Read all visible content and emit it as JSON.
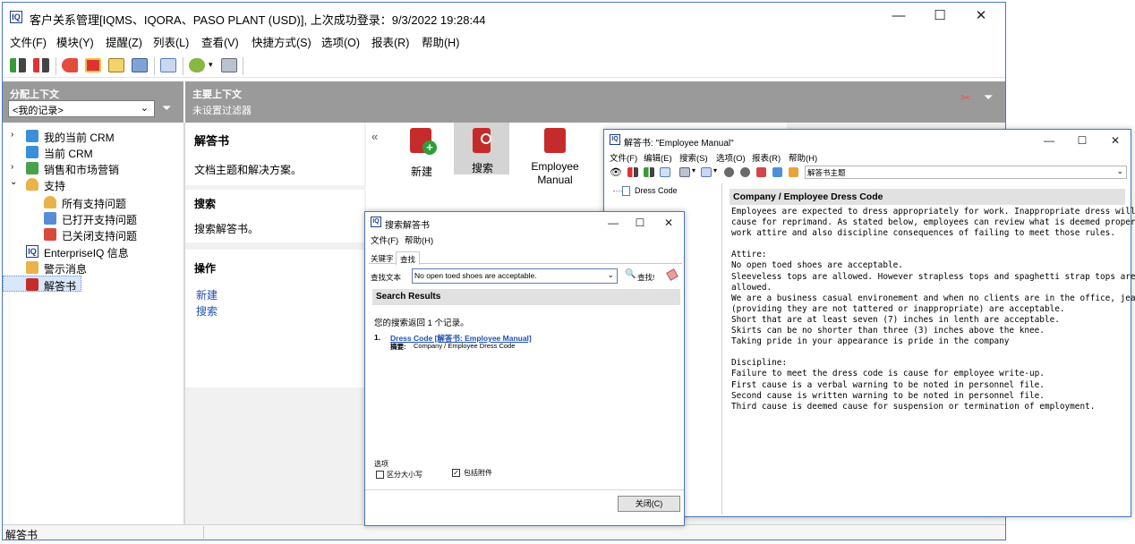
{
  "main": {
    "title": "客户关系管理[IQMS、IQORA、PASO PLANT (USD)], 上次成功登录：9/3/2022 19:28:44",
    "menu": [
      "文件(F)",
      "模块(Y)",
      "提醒(Z)",
      "列表(L)",
      "查看(V)",
      "快捷方式(S)",
      "选项(O)",
      "报表(R)",
      "帮助(H)"
    ],
    "left_header": {
      "title": "分配上下文",
      "select_value": "<我的记录>"
    },
    "tree": [
      "我的当前 CRM",
      "当前 CRM",
      "销售和市场营销",
      "支持",
      "所有支持问题",
      "已打开支持问题",
      "已关闭支持问题",
      "EnterpriseIQ 信息",
      "警示消息",
      "解答书"
    ],
    "context": {
      "title": "主要上下文",
      "subtitle": "未设置过滤器"
    },
    "detail": {
      "heading": "解答书",
      "description": "文档主题和解决方案。",
      "search_heading": "搜索",
      "search_desc": "搜索解答书。",
      "ops_heading": "操作",
      "link_new": "新建",
      "link_search": "搜索",
      "collapse": "«"
    },
    "big_buttons": [
      "新建",
      "搜索",
      "Employee Manual"
    ],
    "status": "解答书"
  },
  "search_window": {
    "title": "搜索解答书",
    "menu": [
      "文件(F)",
      "帮助(H)"
    ],
    "tabs": [
      "关键字",
      "查找"
    ],
    "find_label": "查找文本",
    "find_value": "No open toed shoes are acceptable.",
    "find_button": "查找!",
    "results_header": "Search Results",
    "results_summary": "您的搜索返回 1 个记录。",
    "result": {
      "index": "1.",
      "link": "Dress Code [解答书: Employee Manual]",
      "summary_label": "摘要:",
      "summary_value": "Company / Employee Dress Code"
    },
    "options_label": "选项",
    "opt_case": "区分大小写",
    "opt_attach": "包括附件",
    "close_button": "关闭(C)"
  },
  "manual_window": {
    "title": "解答书: \"Employee Manual\"",
    "menu": [
      "文件(F)",
      "编辑(E)",
      "搜索(S)",
      "选项(O)",
      "报表(R)",
      "帮助(H)"
    ],
    "combo_value": "解答书主题",
    "tree_item": "Dress Code",
    "doc_title": "Company / Employee Dress Code",
    "doc_lines": [
      "Employees are expected to dress appropriately for work. Inappropriate dress will be",
      "cause for reprimand. As stated below, employees can review what is deemed proper",
      "work attire and also discipline consequences of failing to meet those rules.",
      "",
      "Attire:",
      "No open toed shoes are acceptable.",
      "Sleeveless tops are allowed. However strapless tops and spaghetti strap tops are not",
      "allowed.",
      "We are a business casual environement and when no clients are in the office, jeans",
      "(providing they are not tattered or inappropriate) are acceptable.",
      "Short that are at least seven (7) inches in lenth are acceptable.",
      "Skirts can be no shorter than three (3) inches above the knee.",
      "Taking pride in your appearance is pride in the company",
      "",
      "Discipline:",
      "Failure to meet the dress code is cause for employee write-up.",
      "First cause is a verbal warning to be noted in personnel file.",
      "Second cause is written warning to be noted in personnel file.",
      "Third cause is deemed cause for suspension or termination of employment."
    ]
  },
  "colors": {
    "header_gray": "#9a9a9a",
    "accent_blue": "#1f4fb0",
    "border_blue": "#5b7fae"
  }
}
